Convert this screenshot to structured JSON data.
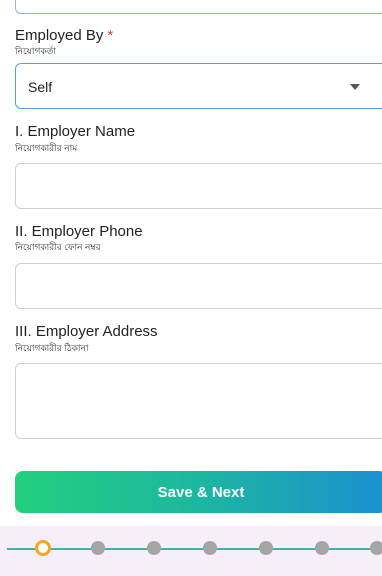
{
  "employed_by": {
    "label": "Employed By",
    "required_mark": "*",
    "sublabel": "নিয়োগকর্তা",
    "selected_value": "Self"
  },
  "employer_name": {
    "label": "I. Employer Name",
    "sublabel": "নিয়োগকারীর নাম",
    "value": ""
  },
  "employer_phone": {
    "label": "II. Employer Phone",
    "sublabel": "নিয়োগকারীর ফোন নম্বর",
    "value": ""
  },
  "employer_address": {
    "label": "III. Employer Address",
    "sublabel": "নিয়োগকারীর ঠিকানা",
    "value": ""
  },
  "save_button": {
    "label": "Save & Next"
  },
  "stepper": {
    "total_visible_steps": 7,
    "active_step": 1,
    "colors": {
      "active_ring": "#f5a623",
      "inactive": "#a5a5a5",
      "line": "#3bb6a0"
    }
  },
  "colors": {
    "accent_gradient_start": "#22d07d",
    "accent_gradient_end": "#1b8fd1",
    "required": "#e53935",
    "focus_border": "#5b9be6"
  }
}
